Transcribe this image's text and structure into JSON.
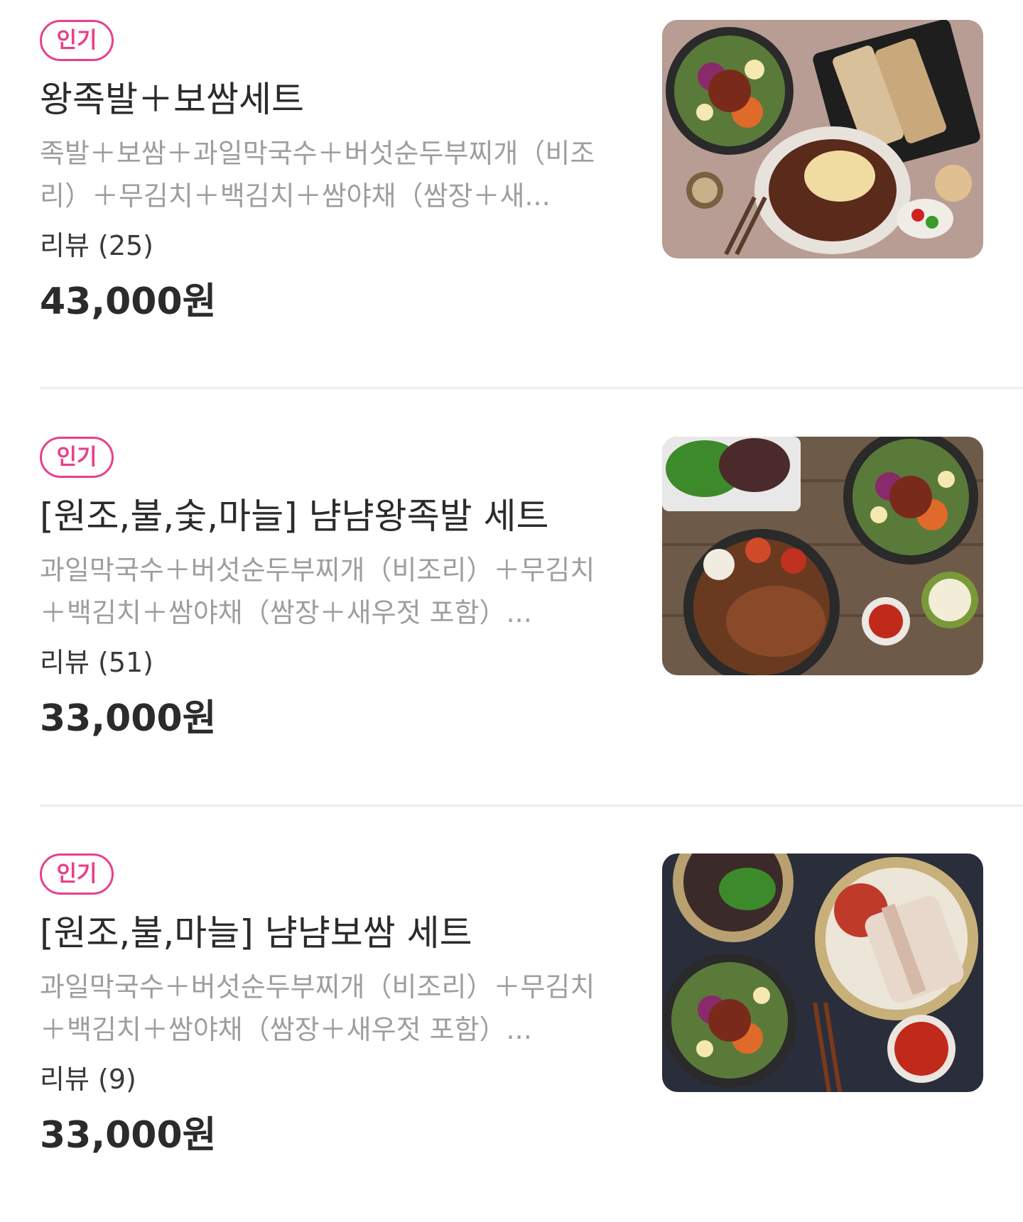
{
  "items": [
    {
      "badge": "인기",
      "title": "왕족발＋보쌈세트",
      "desc": "족발＋보쌈＋과일막국수＋버섯순두부찌개（비조리）＋무김치＋백김치＋쌈야채（쌈장＋새...",
      "review": "리뷰 (25)",
      "price": "43,000원"
    },
    {
      "badge": "인기",
      "title": "[원조,불,숯,마늘] 냠냠왕족발 세트",
      "desc": "과일막국수＋버섯순두부찌개（비조리）＋무김치＋백김치＋쌈야채（쌈장＋새우젓 포함）...",
      "review": "리뷰 (51)",
      "price": "33,000원"
    },
    {
      "badge": "인기",
      "title": "[원조,불,마늘] 냠냠보쌈 세트",
      "desc": "과일막국수＋버섯순두부찌개（비조리）＋무김치＋백김치＋쌈야채（쌈장＋새우젓 포함）...",
      "review": "리뷰 (9)",
      "price": "33,000원"
    }
  ],
  "colors": {
    "badge": "#e8408c",
    "title": "#2b2b2b",
    "desc": "#9e9e9e",
    "divider": "#eeeeee"
  }
}
